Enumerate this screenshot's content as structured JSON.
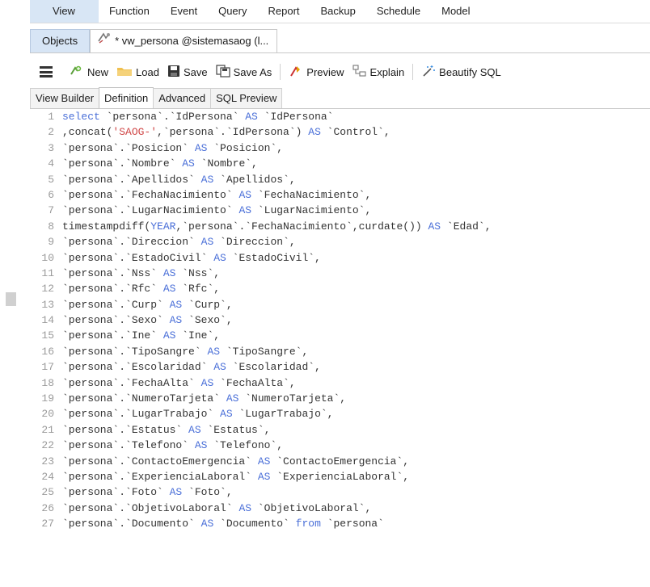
{
  "menubar": {
    "items": [
      "View",
      "Function",
      "Event",
      "Query",
      "Report",
      "Backup",
      "Schedule",
      "Model"
    ]
  },
  "tabs": {
    "objects_label": "Objects",
    "view_tab_label": "* vw_persona @sistemasaog (l..."
  },
  "toolbar": {
    "new_label": "New",
    "load_label": "Load",
    "save_label": "Save",
    "save_as_label": "Save As",
    "preview_label": "Preview",
    "explain_label": "Explain",
    "beautify_label": "Beautify SQL"
  },
  "subtabs": [
    "View Builder",
    "Definition",
    "Advanced",
    "SQL Preview"
  ],
  "active_subtab": "Definition",
  "colors": {
    "keyword": "#4a6fd8",
    "string": "#d04848",
    "active_tab_bg": "#d7e5f5"
  },
  "icons": {
    "menu": "hamburger-icon",
    "new": "new-view-icon",
    "load": "folder-icon",
    "save": "floppy-icon",
    "save_as": "save-as-icon",
    "preview": "preview-icon",
    "explain": "explain-icon",
    "beautify": "magic-wand-icon",
    "view_tab": "view-icon"
  },
  "code_lines": [
    [
      {
        "t": "select",
        "c": "kw"
      },
      {
        "t": " `persona`.`IdPersona` "
      },
      {
        "t": "AS",
        "c": "kw"
      },
      {
        "t": " `IdPersona`"
      }
    ],
    [
      {
        "t": ",concat("
      },
      {
        "t": "'SAOG-'",
        "c": "str"
      },
      {
        "t": ",`persona`.`IdPersona`) "
      },
      {
        "t": "AS",
        "c": "kw"
      },
      {
        "t": " `Control`,"
      }
    ],
    [
      {
        "t": "`persona`.`Posicion` "
      },
      {
        "t": "AS",
        "c": "kw"
      },
      {
        "t": " `Posicion`,"
      }
    ],
    [
      {
        "t": "`persona`.`Nombre` "
      },
      {
        "t": "AS",
        "c": "kw"
      },
      {
        "t": " `Nombre`,"
      }
    ],
    [
      {
        "t": "`persona`.`Apellidos` "
      },
      {
        "t": "AS",
        "c": "kw"
      },
      {
        "t": " `Apellidos`,"
      }
    ],
    [
      {
        "t": "`persona`.`FechaNacimiento` "
      },
      {
        "t": "AS",
        "c": "kw"
      },
      {
        "t": " `FechaNacimiento`,"
      }
    ],
    [
      {
        "t": "`persona`.`LugarNacimiento` "
      },
      {
        "t": "AS",
        "c": "kw"
      },
      {
        "t": " `LugarNacimiento`,"
      }
    ],
    [
      {
        "t": "timestampdiff("
      },
      {
        "t": "YEAR",
        "c": "kw"
      },
      {
        "t": ",`persona`.`FechaNacimiento`,curdate()) "
      },
      {
        "t": "AS",
        "c": "kw"
      },
      {
        "t": " `Edad`,"
      }
    ],
    [
      {
        "t": "`persona`.`Direccion` "
      },
      {
        "t": "AS",
        "c": "kw"
      },
      {
        "t": " `Direccion`,"
      }
    ],
    [
      {
        "t": "`persona`.`EstadoCivil` "
      },
      {
        "t": "AS",
        "c": "kw"
      },
      {
        "t": " `EstadoCivil`,"
      }
    ],
    [
      {
        "t": "`persona`.`Nss` "
      },
      {
        "t": "AS",
        "c": "kw"
      },
      {
        "t": " `Nss`,"
      }
    ],
    [
      {
        "t": "`persona`.`Rfc` "
      },
      {
        "t": "AS",
        "c": "kw"
      },
      {
        "t": " `Rfc`,"
      }
    ],
    [
      {
        "t": "`persona`.`Curp` "
      },
      {
        "t": "AS",
        "c": "kw"
      },
      {
        "t": " `Curp`,"
      }
    ],
    [
      {
        "t": "`persona`.`Sexo` "
      },
      {
        "t": "AS",
        "c": "kw"
      },
      {
        "t": " `Sexo`,"
      }
    ],
    [
      {
        "t": "`persona`.`Ine` "
      },
      {
        "t": "AS",
        "c": "kw"
      },
      {
        "t": " `Ine`,"
      }
    ],
    [
      {
        "t": "`persona`.`TipoSangre` "
      },
      {
        "t": "AS",
        "c": "kw"
      },
      {
        "t": " `TipoSangre`,"
      }
    ],
    [
      {
        "t": "`persona`.`Escolaridad` "
      },
      {
        "t": "AS",
        "c": "kw"
      },
      {
        "t": " `Escolaridad`,"
      }
    ],
    [
      {
        "t": "`persona`.`FechaAlta` "
      },
      {
        "t": "AS",
        "c": "kw"
      },
      {
        "t": " `FechaAlta`,"
      }
    ],
    [
      {
        "t": "`persona`.`NumeroTarjeta` "
      },
      {
        "t": "AS",
        "c": "kw"
      },
      {
        "t": " `NumeroTarjeta`,"
      }
    ],
    [
      {
        "t": "`persona`.`LugarTrabajo` "
      },
      {
        "t": "AS",
        "c": "kw"
      },
      {
        "t": " `LugarTrabajo`,"
      }
    ],
    [
      {
        "t": "`persona`.`Estatus` "
      },
      {
        "t": "AS",
        "c": "kw"
      },
      {
        "t": " `Estatus`,"
      }
    ],
    [
      {
        "t": "`persona`.`Telefono` "
      },
      {
        "t": "AS",
        "c": "kw"
      },
      {
        "t": " `Telefono`,"
      }
    ],
    [
      {
        "t": "`persona`.`ContactoEmergencia` "
      },
      {
        "t": "AS",
        "c": "kw"
      },
      {
        "t": " `ContactoEmergencia`,"
      }
    ],
    [
      {
        "t": "`persona`.`ExperienciaLaboral` "
      },
      {
        "t": "AS",
        "c": "kw"
      },
      {
        "t": " `ExperienciaLaboral`,"
      }
    ],
    [
      {
        "t": "`persona`.`Foto` "
      },
      {
        "t": "AS",
        "c": "kw"
      },
      {
        "t": " `Foto`,"
      }
    ],
    [
      {
        "t": "`persona`.`ObjetivoLaboral` "
      },
      {
        "t": "AS",
        "c": "kw"
      },
      {
        "t": " `ObjetivoLaboral`,"
      }
    ],
    [
      {
        "t": "`persona`.`Documento` "
      },
      {
        "t": "AS",
        "c": "kw"
      },
      {
        "t": " `Documento` "
      },
      {
        "t": "from",
        "c": "kw"
      },
      {
        "t": " `persona`"
      }
    ]
  ]
}
